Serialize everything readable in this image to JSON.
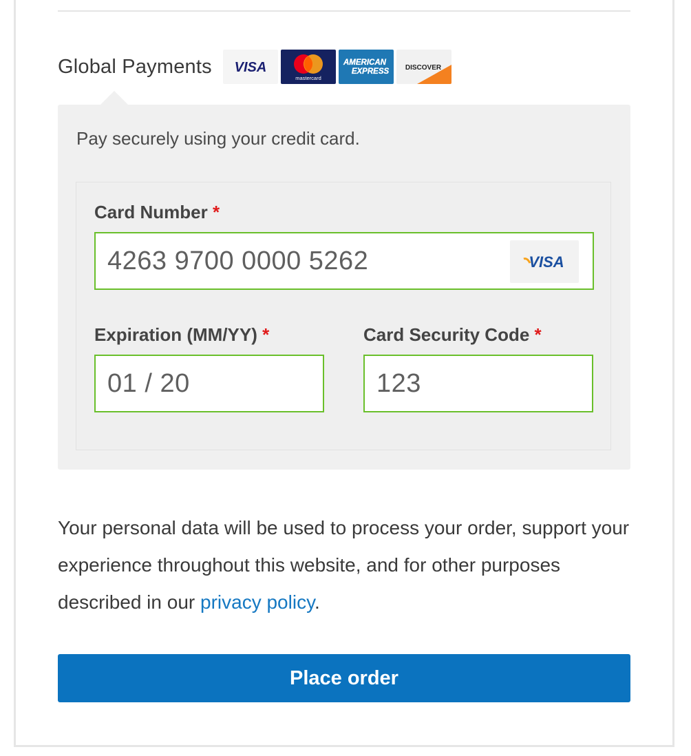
{
  "top_rule": {},
  "payment_method": {
    "label": "Global Payments",
    "card_logos": [
      {
        "name": "visa",
        "text": "VISA",
        "bg": "#f5f5f5"
      },
      {
        "name": "mastercard",
        "text": "mastercard",
        "bg": "#152260"
      },
      {
        "name": "american-express",
        "text_line1": "AMERICAN",
        "text_line2": "EXPRESS",
        "bg": "#1f78b4"
      },
      {
        "name": "discover",
        "text": "DISCOVER",
        "bg": "#f1f1f1"
      }
    ]
  },
  "payment_box": {
    "description": "Pay securely using your credit card.",
    "card_number": {
      "label": "Card Number",
      "required_mark": "*",
      "value": "4263 9700 0000 5262",
      "detected_brand": "VISA"
    },
    "expiration": {
      "label": "Expiration (MM/YY)",
      "required_mark": "*",
      "value": "01 / 20"
    },
    "security_code": {
      "label": "Card Security Code",
      "required_mark": "*",
      "value": "123"
    }
  },
  "privacy_notice": {
    "text_before": "Your personal data will be used to process your order, support your experience throughout this website, and for other purposes described in our ",
    "link_text": "privacy policy",
    "text_after": "."
  },
  "place_order_button": "Place order",
  "colors": {
    "accent": "#0b73bf",
    "link": "#1578c2",
    "valid_border": "#69bf2a",
    "required": "#e01b1b",
    "box_bg": "#f0f0f0"
  }
}
